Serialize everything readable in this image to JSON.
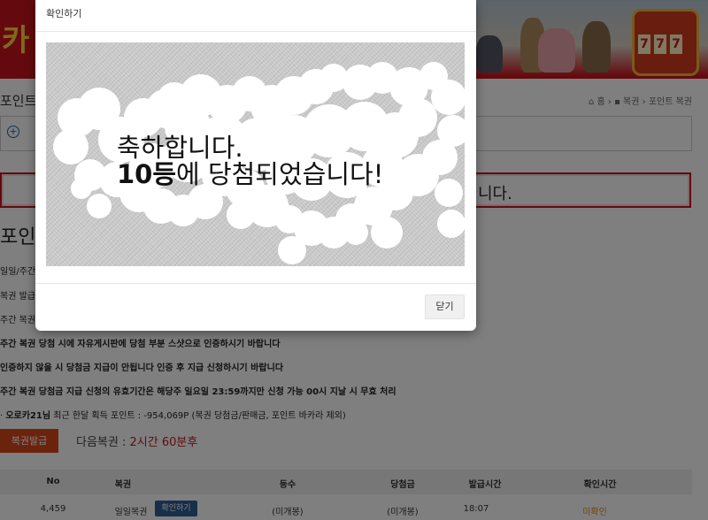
{
  "page": {
    "title_fragment": "포인트",
    "breadcrumb": {
      "home": "홈",
      "section": "복권",
      "current": "포인트 복권"
    },
    "notice_text_fragment": "니다.",
    "section_title_fragment": "포인",
    "rules": [
      "일일/주간",
      "복권 발급",
      "주간 복권",
      "주간 복권 당첨 시에 자유게시판에 당첨 부분 스샷으로 인증하시기 바랍니다",
      "인증하지 않을 시 당첨금 지급이 안됩니다 인증 후 지급 신청하시기 바랍니다",
      "주간 복권 당첨금 지급 신청의 유효기간은 해당주 일요일 23:59까지만 신청 가능 00시 지날 시 무효 처리"
    ],
    "stats_prefix": "· ",
    "stats_user": "오로카21님",
    "stats_text": "최근 한달 획득 포인트 : -954,069P (복권 당첨금/판매금, 포인트 바카라 제외)",
    "issue_button": "복권발급",
    "next_lottery_label": "다음복권 :",
    "next_lottery_time": "2시간 60분후",
    "table": {
      "headers": [
        "No",
        "복권",
        "등수",
        "당첨금",
        "발급시간",
        "확인시간"
      ],
      "row": {
        "no": "4,459",
        "type": "일일복권",
        "confirm_button": "확인하기",
        "rank": "(미개봉)",
        "prize": "(미개봉)",
        "issued": "18:07",
        "checked": "미확인"
      }
    }
  },
  "modal": {
    "title": "확인하기",
    "line1": "축하합니다.",
    "rank_bold": "10등",
    "line2_rest": "에 당첨되었습니다!",
    "close_button": "닫기"
  },
  "colors": {
    "brand_red": "#c8151c",
    "button_orange": "#d9471c",
    "button_blue": "#2f5f96",
    "status_orange": "#e08a1e"
  }
}
